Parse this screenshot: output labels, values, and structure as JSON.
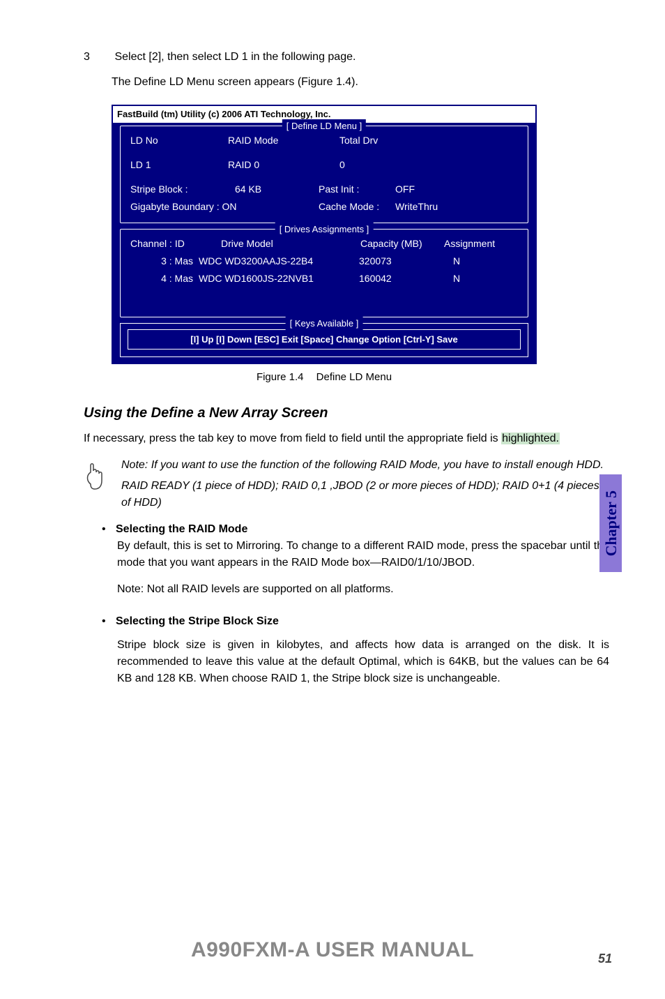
{
  "step": {
    "number": "3",
    "text": "Select [2], then select LD 1 in the following page.",
    "sub": "The Define LD Menu screen appears (Figure 1.4)."
  },
  "bios": {
    "title": "FastBuild (tm) Utility (c) 2006 ATI Technology, Inc.",
    "defineMenu": {
      "label": "[ Define LD Menu ]",
      "header": {
        "c1": "LD No",
        "c2": "RAID Mode",
        "c3": "Total Drv"
      },
      "row": {
        "c1": "LD 1",
        "c2": "RAID 0",
        "c3": "0"
      },
      "stripe": {
        "lab1": "Stripe Block :",
        "val1": "64  KB",
        "lab2": "Past Init :",
        "val2": "OFF"
      },
      "gig": {
        "lab1": "Gigabyte Boundary :  ON",
        "lab2": "Cache Mode :",
        "val2": "WriteThru"
      }
    },
    "drives": {
      "label": "[ Drives Assignments ]",
      "header": {
        "c1": "Channel : ID",
        "c2": "Drive Model",
        "c3": "Capacity (MB)",
        "c4": "Assignment"
      },
      "rows": [
        {
          "c1": "3 : Mas",
          "c2": "WDC  WD3200AAJS-22B4",
          "c3": "320073",
          "c4": "N"
        },
        {
          "c1": "4 : Mas",
          "c2": "WDC  WD1600JS-22NVB1",
          "c3": "160042",
          "c4": "N"
        }
      ]
    },
    "keys": {
      "label": "[ Keys Available ]",
      "content": "[I] Up   [I] Down   [ESC] Exit    [Space] Change Option    [Ctrl-Y] Save"
    }
  },
  "caption": {
    "no": "Figure 1.4",
    "text": "Define LD Menu"
  },
  "heading": "Using the Define a New Array Screen",
  "para1": "If necessary, press the tab key to move from field to field until the appropriate field is ",
  "para1h": "highlighted.",
  "note": {
    "p1": "Note: If you want to use the function of the following RAID Mode, you have to install enough HDD.",
    "p2": "RAID READY (1 piece of HDD); RAID 0,1 ,JBOD (2 or more pieces of HDD); RAID 0+1 (4 pieces of HDD)"
  },
  "section1": {
    "title": "Selecting the RAID Mode",
    "p1": "By default, this is set to Mirroring. To change to a different RAID mode, press the spacebar until the mode that you want appears in the RAID Mode box—RAID0/1/10/JBOD.",
    "p2": "Note: Not all RAID levels are supported on all platforms."
  },
  "section2": {
    "title": "Selecting the Stripe Block Size",
    "p1": "Stripe block size is given in kilobytes, and affects how data is arranged on the disk. It is recommended to leave this value at the default Optimal, which is 64KB, but the values can be 64 KB and 128 KB. When choose RAID 1, the Stripe block size is unchangeable."
  },
  "chapter": "Chapter 5",
  "chart_data": {
    "type": "table",
    "title": "Drives Assignments",
    "columns": [
      "Channel : ID",
      "Drive Model",
      "Capacity (MB)",
      "Assignment"
    ],
    "rows": [
      [
        "3 : Mas",
        "WDC WD3200AAJS-22B4",
        320073,
        "N"
      ],
      [
        "4 : Mas",
        "WDC WD1600JS-22NVB1",
        160042,
        "N"
      ]
    ]
  },
  "footer": {
    "title": "A990FXM-A USER MANUAL",
    "page": "51"
  }
}
